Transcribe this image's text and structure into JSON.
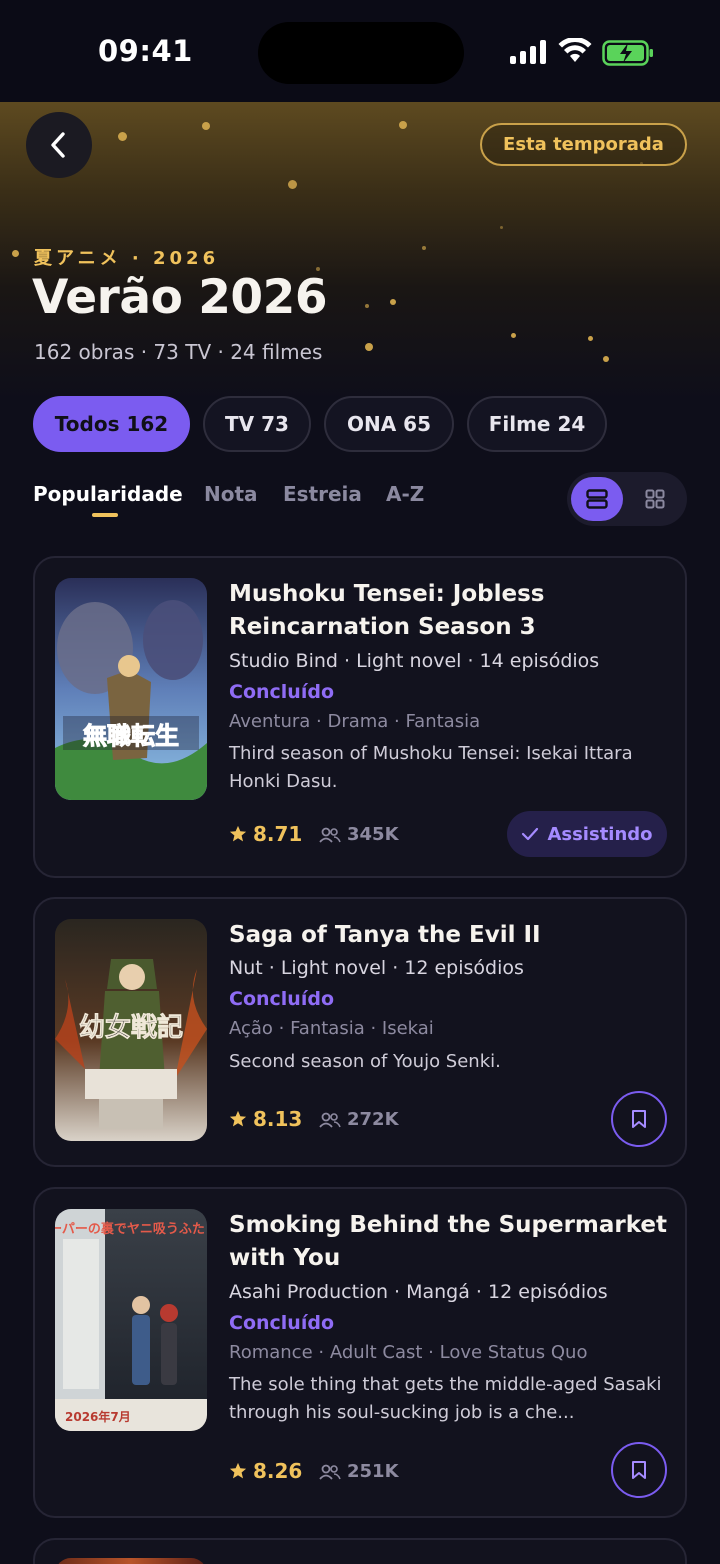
{
  "status_bar": {
    "time": "09:41"
  },
  "header": {
    "season_chip": "Esta temporada",
    "kicker": "夏アニメ · 2026",
    "title": "Verão 2026",
    "subtitle": "162 obras · 73 TV · 24 filmes"
  },
  "filters": [
    {
      "label": "Todos 162",
      "active": true
    },
    {
      "label": "TV 73",
      "active": false
    },
    {
      "label": "ONA 65",
      "active": false
    },
    {
      "label": "Filme 24",
      "active": false
    }
  ],
  "sort_tabs": [
    {
      "label": "Popularidade",
      "active": true
    },
    {
      "label": "Nota",
      "active": false
    },
    {
      "label": "Estreia",
      "active": false
    },
    {
      "label": "A-Z",
      "active": false
    }
  ],
  "view_mode": "list",
  "colors": {
    "accent": "#7b5cf0",
    "gold": "#f0c25c",
    "background": "#0e0e1a",
    "card": "#12121e"
  },
  "anime": [
    {
      "title": "Mushoku Tensei: Jobless Reincarnation Season 3",
      "meta": "Studio Bind · Light novel · 14 episódios",
      "status": "Concluído",
      "genres": "Aventura · Drama · Fantasia",
      "description": "Third season of Mushoku Tensei: Isekai Ittara Honki Dasu.",
      "rating": "8.71",
      "members": "345K",
      "action": "Assistindo",
      "poster_text": "無職転生"
    },
    {
      "title": "Saga of Tanya the Evil II",
      "meta": "Nut · Light novel · 12 episódios",
      "status": "Concluído",
      "genres": "Ação · Fantasia · Isekai",
      "description": "Second season of Youjo Senki.",
      "rating": "8.13",
      "members": "272K",
      "action": "bookmark",
      "poster_text": "幼女戦記"
    },
    {
      "title": "Smoking Behind the Supermarket with You",
      "meta": "Asahi Production · Mangá · 12 episódios",
      "status": "Concluído",
      "genres": "Romance · Adult Cast · Love Status Quo",
      "description": "The sole thing that gets the middle-aged Sasaki through his soul-sucking job is a che...",
      "rating": "8.26",
      "members": "251K",
      "action": "bookmark",
      "poster_text": "スーパーの裏でヤニ吸うふたり",
      "poster_date": "2026年7月"
    }
  ]
}
